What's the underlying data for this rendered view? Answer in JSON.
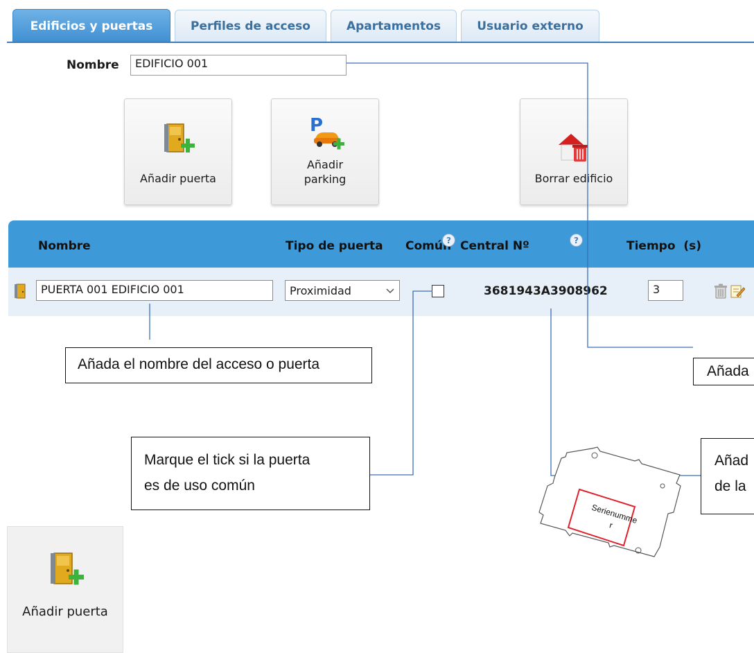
{
  "tabs": [
    {
      "label": "Edificios y puertas",
      "active": true
    },
    {
      "label": "Perfiles de acceso",
      "active": false
    },
    {
      "label": "Apartamentos",
      "active": false
    },
    {
      "label": "Usuario externo",
      "active": false
    }
  ],
  "building": {
    "name_label": "Nombre",
    "name_value": "EDIFICIO 001"
  },
  "actions": {
    "add_door": "Añadir puerta",
    "add_parking_line1": "Añadir",
    "add_parking_line2": "parking",
    "delete_building": "Borrar edificio"
  },
  "table": {
    "headers": {
      "nombre": "Nombre",
      "tipo": "Tipo de puerta",
      "comun": "Común",
      "central": "Central Nº",
      "tiempo": "Tiempo  (s)"
    },
    "row": {
      "name": "PUERTA 001 EDIFICIO 001",
      "type": "Proximidad",
      "common": false,
      "central": "3681943A3908962",
      "time": "3"
    }
  },
  "callouts": {
    "name_hint": "Añada el nombre del acceso o puerta",
    "common_hint_line1": "Marque el tick si la puerta",
    "common_hint_line2": "es de uso común",
    "right_top": "Añada",
    "right_bottom_line1": "Añad",
    "right_bottom_line2": "de la"
  },
  "board": {
    "label_line1": "Serienumme",
    "label_line2": "r"
  },
  "bottom_button": {
    "label": "Añadir puerta"
  },
  "colors": {
    "accent": "#3d99d8",
    "row_bg": "#e7f0f9",
    "connector": "#3a6fb8",
    "board_label": "#e0202a"
  }
}
